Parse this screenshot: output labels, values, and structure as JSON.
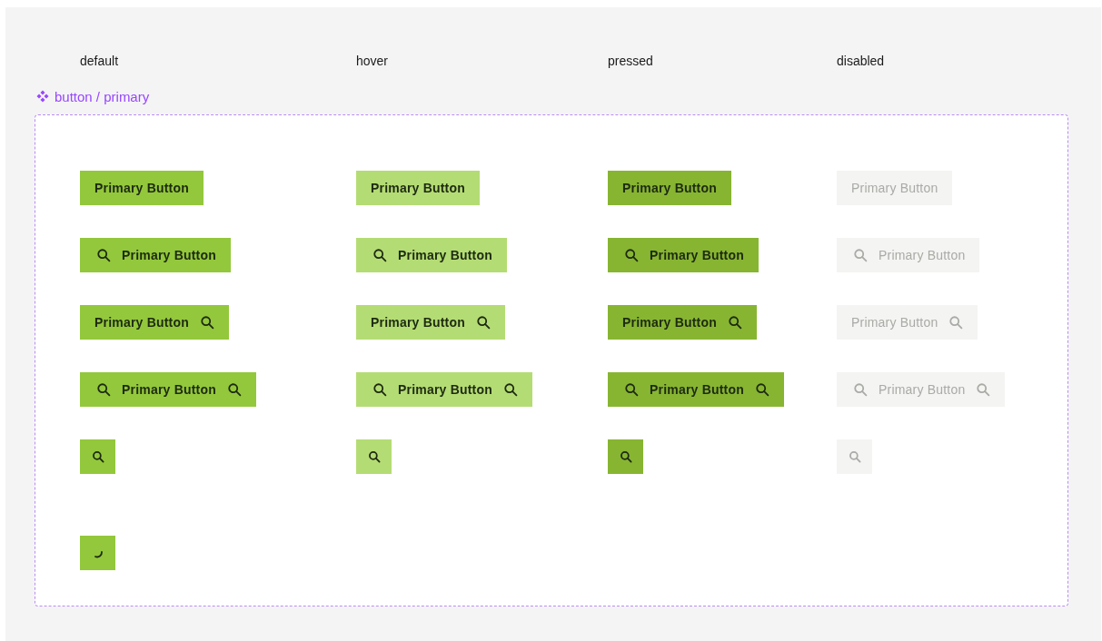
{
  "component": {
    "title": "button / primary"
  },
  "columns": [
    {
      "header": "default",
      "kind": "base",
      "buttons": [
        {
          "kind": "text",
          "label": "Primary Button"
        },
        {
          "kind": "icon-left",
          "label": "Primary Button"
        },
        {
          "kind": "icon-right",
          "label": "Primary Button"
        },
        {
          "kind": "icon-both",
          "label": "Primary Button"
        },
        {
          "kind": "icon-only"
        },
        {
          "kind": "loading"
        }
      ]
    },
    {
      "header": "hover",
      "kind": "hovering",
      "buttons": [
        {
          "kind": "text",
          "label": "Primary Button"
        },
        {
          "kind": "icon-left",
          "label": "Primary Button"
        },
        {
          "kind": "icon-right",
          "label": "Primary Button"
        },
        {
          "kind": "icon-both",
          "label": "Primary Button"
        },
        {
          "kind": "icon-only"
        }
      ]
    },
    {
      "header": "pressed",
      "kind": "active",
      "buttons": [
        {
          "kind": "text",
          "label": "Primary Button"
        },
        {
          "kind": "icon-left",
          "label": "Primary Button"
        },
        {
          "kind": "icon-right",
          "label": "Primary Button"
        },
        {
          "kind": "icon-both",
          "label": "Primary Button"
        },
        {
          "kind": "icon-only"
        }
      ]
    },
    {
      "header": "disabled",
      "kind": "inactive",
      "buttons": [
        {
          "kind": "text",
          "label": "Primary Button"
        },
        {
          "kind": "icon-left",
          "label": "Primary Button"
        },
        {
          "kind": "icon-right",
          "label": "Primary Button"
        },
        {
          "kind": "icon-both",
          "label": "Primary Button"
        },
        {
          "kind": "icon-only"
        }
      ]
    }
  ]
}
